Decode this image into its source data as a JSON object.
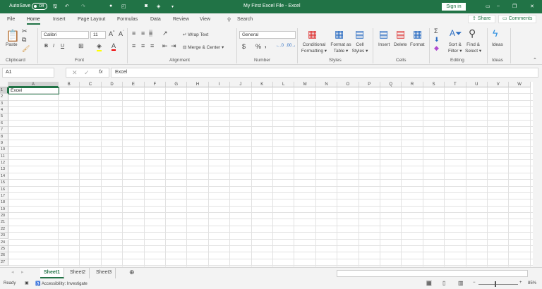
{
  "title_bar": {
    "autosave_label": "AutoSave",
    "autosave_state": "Off",
    "title": "My First Excel File  -  Excel",
    "sign_in": "Sign in"
  },
  "tabs": [
    "File",
    "Home",
    "Insert",
    "Page Layout",
    "Formulas",
    "Data",
    "Review",
    "View"
  ],
  "search_label": "Search",
  "share_label": "Share",
  "comments_label": "Comments",
  "ribbon": {
    "clipboard": {
      "paste": "Paste",
      "group": "Clipboard"
    },
    "font": {
      "name": "Calibri",
      "size": "11",
      "bold": "B",
      "italic": "I",
      "underline": "U",
      "group": "Font"
    },
    "alignment": {
      "wrap": "Wrap Text",
      "merge": "Merge & Center",
      "group": "Alignment"
    },
    "number": {
      "format": "General",
      "currency": "$",
      "percent": "%",
      "comma": ",",
      "group": "Number"
    },
    "styles": {
      "conditional1": "Conditional",
      "conditional2": "Formatting",
      "table1": "Format as",
      "table2": "Table",
      "cell1": "Cell",
      "cell2": "Styles",
      "group": "Styles"
    },
    "cells": {
      "insert": "Insert",
      "delete": "Delete",
      "format": "Format",
      "group": "Cells"
    },
    "editing": {
      "sort1": "Sort &",
      "sort2": "Filter",
      "find1": "Find &",
      "find2": "Select",
      "group": "Editing"
    },
    "ideas": {
      "label": "Ideas",
      "group": "Ideas"
    }
  },
  "formula_bar": {
    "name_box": "A1",
    "formula": "Excel",
    "fx": "fx"
  },
  "columns": [
    "A",
    "B",
    "C",
    "D",
    "E",
    "F",
    "G",
    "H",
    "I",
    "J",
    "K",
    "L",
    "M",
    "N",
    "O",
    "P",
    "Q",
    "R",
    "S",
    "T",
    "U",
    "V",
    "W"
  ],
  "rows": [
    "1",
    "2",
    "3",
    "4",
    "5",
    "6",
    "7",
    "8",
    "9",
    "10",
    "11",
    "12",
    "13",
    "14",
    "15",
    "16",
    "17",
    "18",
    "19",
    "20",
    "21",
    "22",
    "23",
    "24",
    "25",
    "26",
    "27"
  ],
  "cells": {
    "A1": "Excel"
  },
  "sheets": [
    "Sheet1",
    "Sheet2",
    "Sheet3"
  ],
  "active_sheet": "Sheet1",
  "status": {
    "ready": "Ready",
    "accessibility": "Accessibility: Investigate",
    "zoom": "85%"
  }
}
